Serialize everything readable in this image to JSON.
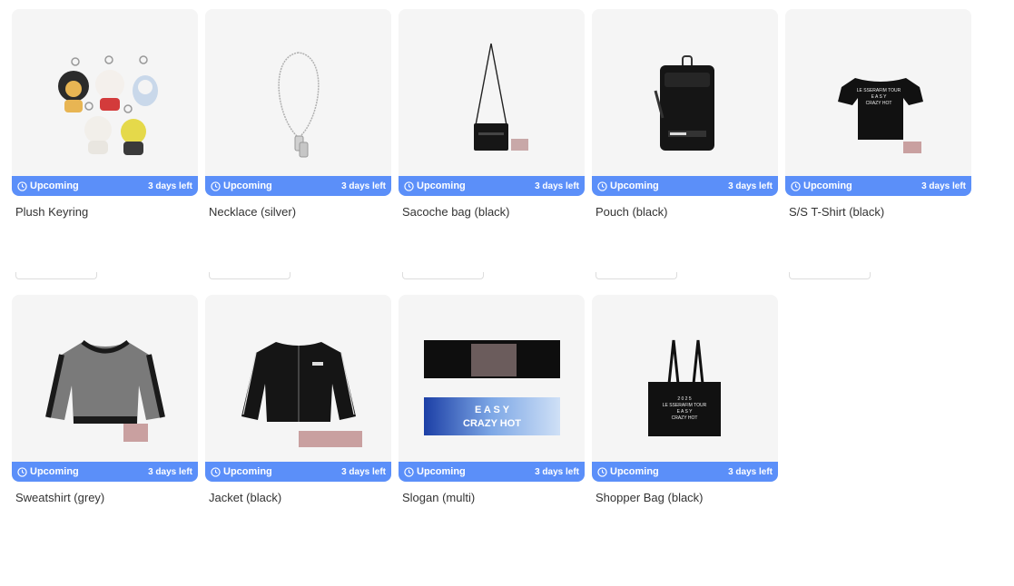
{
  "products": [
    {
      "name": "Plush Keyring",
      "status": "Upcoming",
      "time_left": "3 days left"
    },
    {
      "name": "Necklace (silver)",
      "status": "Upcoming",
      "time_left": "3 days left"
    },
    {
      "name": "Sacoche bag (black)",
      "status": "Upcoming",
      "time_left": "3 days left"
    },
    {
      "name": "Pouch (black)",
      "status": "Upcoming",
      "time_left": "3 days left"
    },
    {
      "name": "S/S T-Shirt (black)",
      "status": "Upcoming",
      "time_left": "3 days left"
    },
    {
      "name": "Sweatshirt (grey)",
      "status": "Upcoming",
      "time_left": "3 days left"
    },
    {
      "name": "Jacket (black)",
      "status": "Upcoming",
      "time_left": "3 days left"
    },
    {
      "name": "Slogan (multi)",
      "status": "Upcoming",
      "time_left": "3 days left"
    },
    {
      "name": "Shopper Bag (black)",
      "status": "Upcoming",
      "time_left": "3 days left"
    }
  ],
  "print": {
    "tshirt_line1": "LE SSERAFIM TOUR",
    "tshirt_line2": "E A S Y",
    "tshirt_line3": "CRAZY HOT",
    "slogan_word1": "E A S Y",
    "slogan_word2": "CRAZY HOT",
    "shopper_line1": "2 0 2 5",
    "shopper_line2": "LE SSERAFIM TOUR",
    "shopper_line3": "E A S Y",
    "shopper_line4": "CRAZY HOT"
  },
  "colors": {
    "accent": "#5b8ff9",
    "card_bg": "#f5f5f5"
  },
  "icons": {
    "status": "clock-icon"
  }
}
